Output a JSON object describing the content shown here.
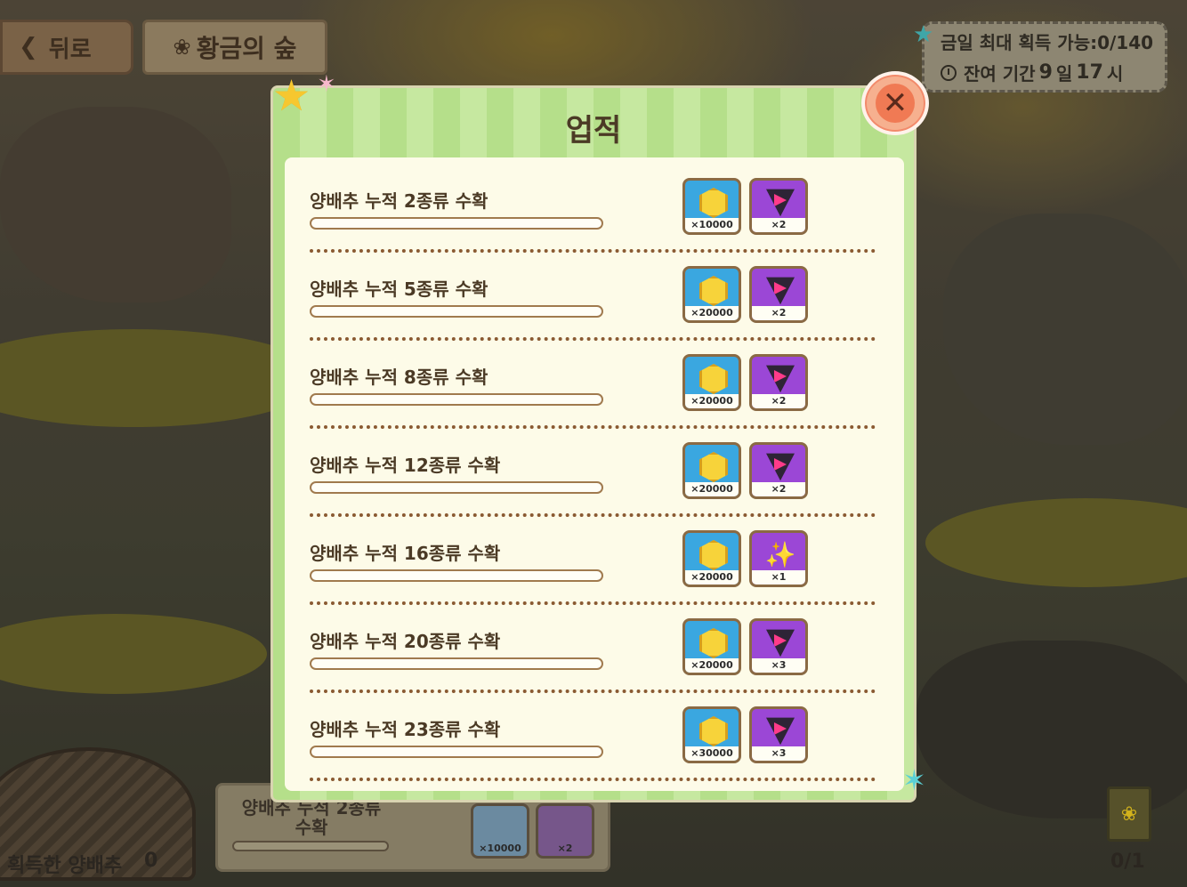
{
  "header": {
    "back_label": "뒤로",
    "title": "황금의 숲"
  },
  "info": {
    "daily_max_label": "금일 최대 획득 가능:0/140",
    "remaining_prefix": "잔여 기간",
    "remaining_days": "9",
    "day_unit": "일",
    "remaining_hours": "17",
    "hour_unit": "시"
  },
  "modal": {
    "title": "업적",
    "achievements": [
      {
        "title": "양배추 누적 2종류 수확",
        "gold_qty": "×10000",
        "item_type": "crystal",
        "item_qty": "×2"
      },
      {
        "title": "양배추 누적 5종류 수확",
        "gold_qty": "×20000",
        "item_type": "crystal",
        "item_qty": "×2"
      },
      {
        "title": "양배추 누적 8종류 수확",
        "gold_qty": "×20000",
        "item_type": "crystal",
        "item_qty": "×2"
      },
      {
        "title": "양배추 누적 12종류 수확",
        "gold_qty": "×20000",
        "item_type": "crystal",
        "item_qty": "×2"
      },
      {
        "title": "양배추 누적 16종류 수확",
        "gold_qty": "×20000",
        "item_type": "wand",
        "item_qty": "×1"
      },
      {
        "title": "양배추 누적 20종류 수확",
        "gold_qty": "×20000",
        "item_type": "crystal",
        "item_qty": "×3"
      },
      {
        "title": "양배추 누적 23종류 수확",
        "gold_qty": "×30000",
        "item_type": "crystal",
        "item_qty": "×3"
      }
    ]
  },
  "background_card": {
    "title": "양배추 누적 2종류 수확",
    "gold_qty": "×10000",
    "item_qty": "×2"
  },
  "bottom": {
    "obtained_label": "획득한 양배추",
    "obtained_count": "0",
    "seed_count": "0/1"
  },
  "colors": {
    "modal_bg": "#b5df8a",
    "inner_bg": "#fdfbe8",
    "text_brown": "#4b3a25",
    "gold_slot": "#3aa7e0",
    "item_slot": "#9b47d6",
    "close_accent": "#f07a54"
  },
  "icons": {
    "back": "chevron-left-icon",
    "title": "sprout-icon",
    "clock": "clock-icon",
    "close": "close-icon",
    "gold": "gold-coin-icon",
    "crystal": "crystal-triangle-icon",
    "wand": "magic-wand-icon"
  }
}
